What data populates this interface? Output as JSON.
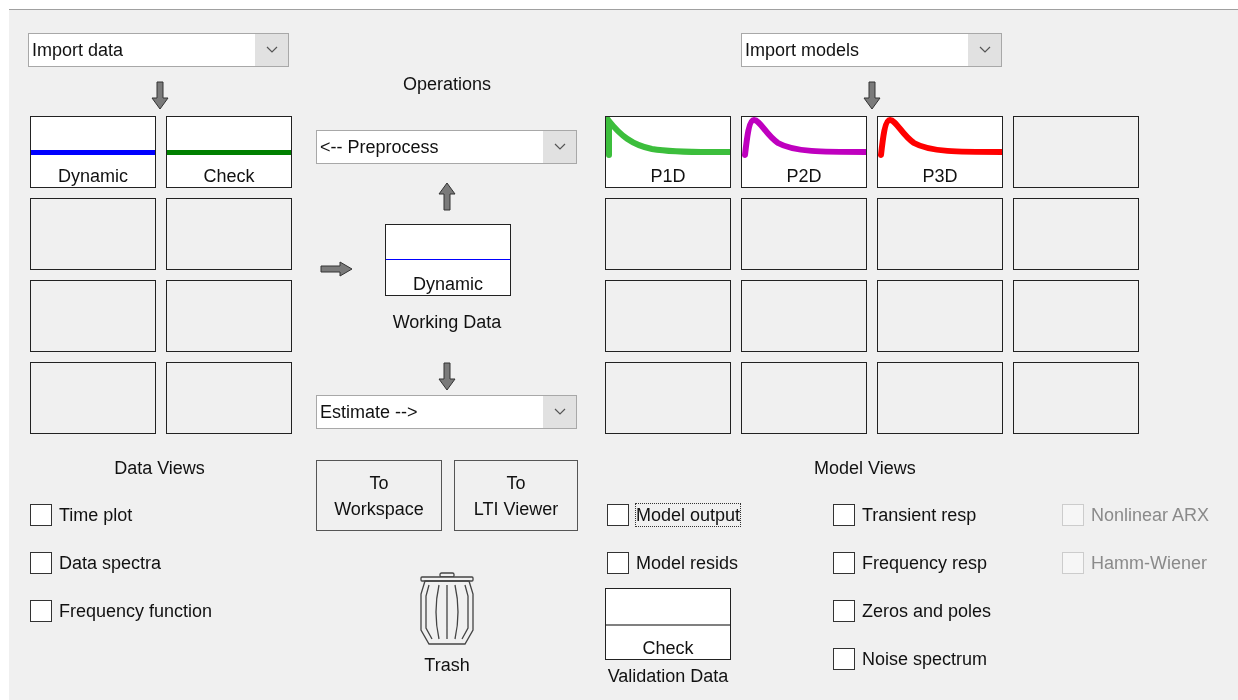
{
  "data_import": {
    "label": "Import data"
  },
  "data_boards": [
    {
      "kind": "signal",
      "label": "Dynamic",
      "color": "#0000ff"
    },
    {
      "kind": "signal",
      "label": "Check",
      "color": "#008000"
    },
    {
      "kind": "empty"
    },
    {
      "kind": "empty"
    },
    {
      "kind": "empty"
    },
    {
      "kind": "empty"
    },
    {
      "kind": "empty"
    },
    {
      "kind": "empty"
    }
  ],
  "data_views": {
    "title": "Data Views",
    "options": [
      {
        "label": "Time plot",
        "checked": false,
        "disabled": false,
        "focused": false
      },
      {
        "label": "Data spectra",
        "checked": false,
        "disabled": false,
        "focused": false
      },
      {
        "label": "Frequency function",
        "checked": false,
        "disabled": false,
        "focused": false
      }
    ]
  },
  "operations": {
    "title": "Operations",
    "preprocess": "<-- Preprocess",
    "working_data": {
      "label": "Dynamic",
      "color": "#0000ff"
    },
    "working_data_title": "Working Data",
    "estimate": "Estimate -->",
    "buttons": [
      "To\nWorkspace",
      "To\nLTI Viewer"
    ],
    "trash": "Trash"
  },
  "model_import": {
    "label": "Import models"
  },
  "model_boards": [
    {
      "kind": "decay",
      "label": "P1D",
      "color": "#3cbe3c"
    },
    {
      "kind": "hump",
      "label": "P2D",
      "color": "#bf00bf"
    },
    {
      "kind": "hump",
      "label": "P3D",
      "color": "#ff0000"
    },
    {
      "kind": "empty"
    },
    {
      "kind": "empty"
    },
    {
      "kind": "empty"
    },
    {
      "kind": "empty"
    },
    {
      "kind": "empty"
    },
    {
      "kind": "empty"
    },
    {
      "kind": "empty"
    },
    {
      "kind": "empty"
    },
    {
      "kind": "empty"
    },
    {
      "kind": "empty"
    },
    {
      "kind": "empty"
    },
    {
      "kind": "empty"
    },
    {
      "kind": "empty"
    }
  ],
  "model_views": {
    "title": "Model Views",
    "columns": [
      [
        {
          "label": "Model output",
          "checked": false,
          "disabled": false,
          "focused": true
        },
        {
          "label": "Model resids",
          "checked": false,
          "disabled": false,
          "focused": false
        }
      ],
      [
        {
          "label": "Transient resp",
          "checked": false,
          "disabled": false,
          "focused": false
        },
        {
          "label": "Frequency resp",
          "checked": false,
          "disabled": false,
          "focused": false
        },
        {
          "label": "Zeros and poles",
          "checked": false,
          "disabled": false,
          "focused": false
        },
        {
          "label": "Noise spectrum",
          "checked": false,
          "disabled": false,
          "focused": false
        }
      ],
      [
        {
          "label": "Nonlinear ARX",
          "checked": false,
          "disabled": true,
          "focused": false
        },
        {
          "label": "Hamm-Wiener",
          "checked": false,
          "disabled": true,
          "focused": false
        }
      ]
    ]
  },
  "validation_data": {
    "label": "Check",
    "color": "#808080",
    "title": "Validation Data"
  }
}
